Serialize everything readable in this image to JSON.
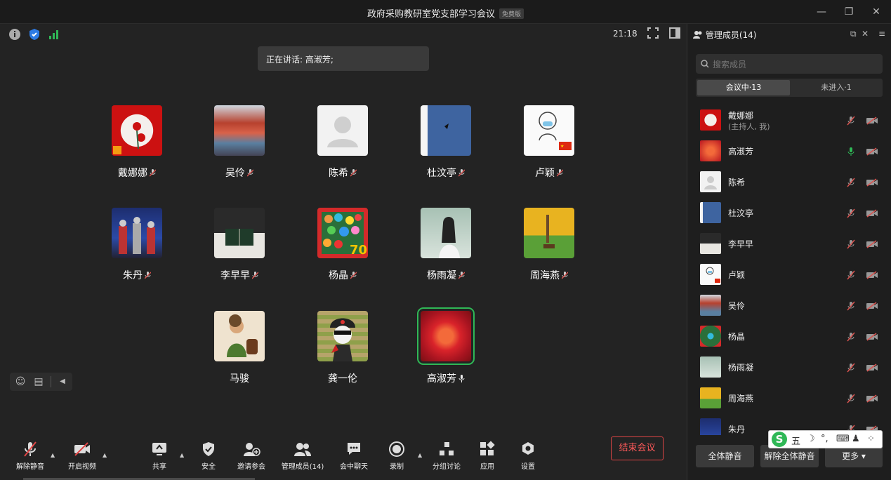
{
  "window": {
    "title": "政府采购教研室党支部学习会议",
    "edition": "免费版",
    "minimize_label": "—",
    "maximize_label": "❐",
    "close_label": "✕"
  },
  "status": {
    "time": "21:18",
    "speaking_label": "正在讲话: 高淑芳;"
  },
  "participants": [
    {
      "name": "戴娜娜",
      "muted": true
    },
    {
      "name": "吴伶",
      "muted": true
    },
    {
      "name": "陈希",
      "muted": true
    },
    {
      "name": "杜汶亭",
      "muted": true
    },
    {
      "name": "卢颖",
      "muted": true
    },
    {
      "name": "朱丹",
      "muted": true
    },
    {
      "name": "李早早",
      "muted": true
    },
    {
      "name": "杨晶",
      "muted": true
    },
    {
      "name": "杨雨凝",
      "muted": true
    },
    {
      "name": "周海燕",
      "muted": true
    },
    {
      "name": "马骏",
      "muted": null
    },
    {
      "name": "龚一伦",
      "muted": null
    },
    {
      "name": "高淑芳",
      "muted": false,
      "speaking": true
    }
  ],
  "toolbar": {
    "unmute": "解除静音",
    "start_video": "开启视频",
    "share": "共享",
    "security": "安全",
    "invite": "邀请参会",
    "manage": "管理成员(14)",
    "chat": "会中聊天",
    "record": "录制",
    "breakout": "分组讨论",
    "apps": "应用",
    "settings": "设置",
    "end": "结束会议"
  },
  "panel": {
    "title": "管理成员(14)",
    "search_placeholder": "搜索成员",
    "tab_in_meeting": "会议中·13",
    "tab_not_joined": "未进入·1",
    "host_note": "(主持人, 我)",
    "members": [
      {
        "name": "戴娜娜",
        "mic": "muted"
      },
      {
        "name": "高淑芳",
        "mic": "on"
      },
      {
        "name": "陈希",
        "mic": "muted"
      },
      {
        "name": "杜汶亭",
        "mic": "muted"
      },
      {
        "name": "李早早",
        "mic": "muted"
      },
      {
        "name": "卢颖",
        "mic": "muted"
      },
      {
        "name": "吴伶",
        "mic": "muted"
      },
      {
        "name": "杨晶",
        "mic": "muted"
      },
      {
        "name": "杨雨凝",
        "mic": "muted"
      },
      {
        "name": "周海燕",
        "mic": "muted"
      },
      {
        "name": "朱丹",
        "mic": "muted"
      }
    ],
    "mute_all": "全体静音",
    "unmute_all": "解除全体静音",
    "more": "更多 ▾"
  },
  "ime": {
    "s": "S",
    "wu": "五",
    "moon": "☽",
    "dot": "°,",
    "kb": "⌨",
    "person": "♟",
    "grid": "⁘"
  },
  "colors": {
    "accent_green": "#2fb856",
    "end_red": "#e04545",
    "mute_red": "#d9534f"
  }
}
